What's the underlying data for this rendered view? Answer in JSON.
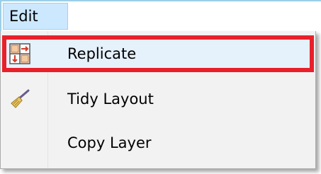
{
  "menubar": {
    "edit_label": "Edit"
  },
  "menu": {
    "items": [
      {
        "label": "Replicate",
        "icon": "replicate-icon",
        "highlighted": true
      },
      {
        "label": "Tidy Layout",
        "icon": "broom-icon",
        "highlighted": false
      },
      {
        "label": "Copy Layer",
        "icon": "",
        "highlighted": false
      }
    ]
  },
  "colors": {
    "menubar_highlight": "#cce8ff",
    "highlight_border": "#e8202a",
    "menu_background": "#f2f2f2"
  }
}
